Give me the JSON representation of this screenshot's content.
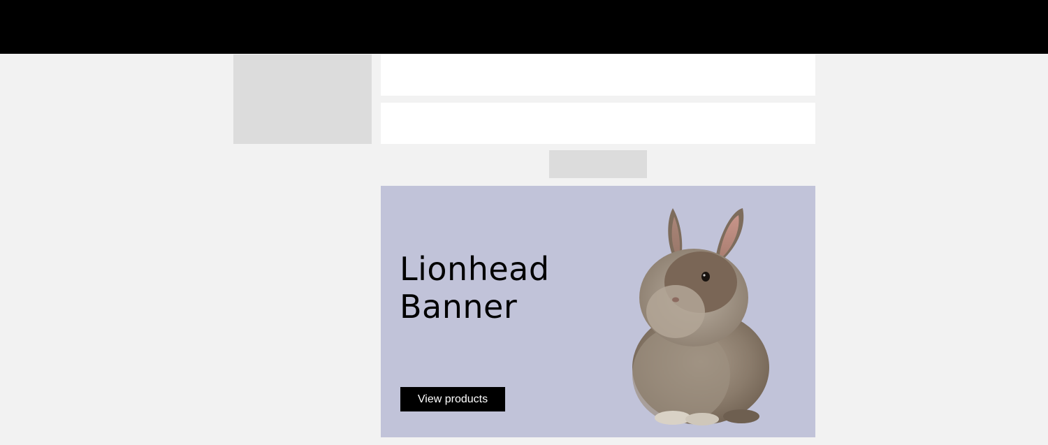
{
  "banner": {
    "title_line1": "Lionhead",
    "title_line2": "Banner",
    "button_label": "View products",
    "background_color": "#c1c3d9",
    "image_icon": "rabbit-image"
  },
  "colors": {
    "topbar": "#000000",
    "page_background": "#f2f2f2",
    "placeholder": "#dcdcdc",
    "panel": "#ffffff",
    "button": "#000000",
    "button_text": "#ffffff"
  }
}
